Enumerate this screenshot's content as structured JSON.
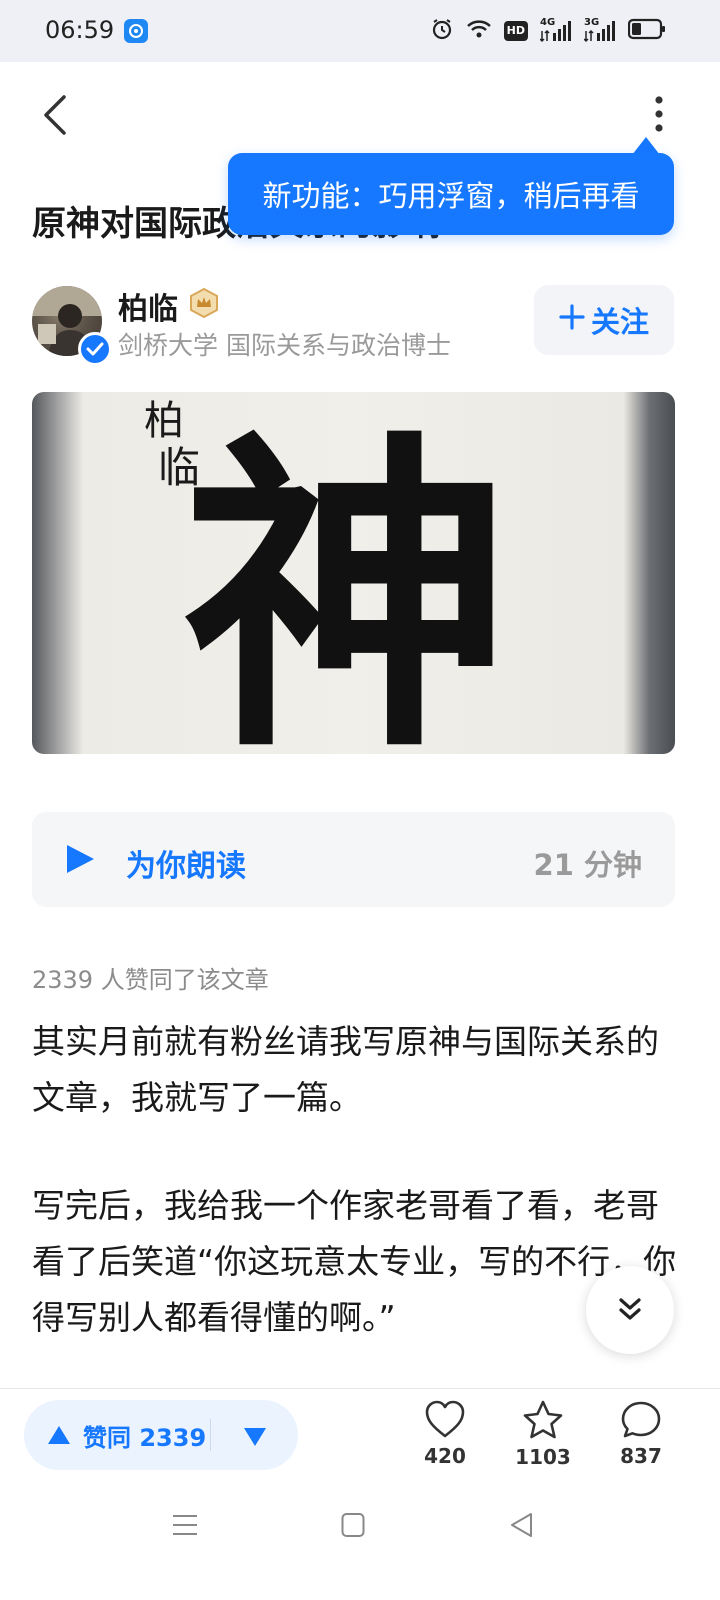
{
  "status_bar": {
    "time": "06:59",
    "icons": [
      "app-notification-icon",
      "alarm-icon",
      "wifi-icon",
      "hd-icon",
      "signal-4g-icon",
      "signal-3g-icon",
      "battery-icon"
    ],
    "hd_label": "HD",
    "net1": "4G",
    "net2": "3G"
  },
  "header": {
    "back_icon": "back-arrow-icon",
    "more_icon": "more-vertical-icon"
  },
  "tooltip": {
    "text": "新功能：巧用浮窗，稍后再看"
  },
  "article": {
    "title": "原神对国际政治关系的影响",
    "image_chars": [
      "柏",
      "临",
      "神"
    ]
  },
  "author": {
    "name": "柏临",
    "desc": "剑桥大学 国际关系与政治博士",
    "follow_label": "关注"
  },
  "listen": {
    "label": "为你朗读",
    "duration": "21 分钟"
  },
  "stats": {
    "likes_line": "2339 人赞同了该文章"
  },
  "body": {
    "p1": "其实月前就有粉丝请我写原神与国际关系的文章，我就写了一篇。",
    "p2": "写完后，我给我一个作家老哥看了看，老哥看了后笑道“你这玩意太专业，写的不行，你得写别人都看得懂的啊。”"
  },
  "actions": {
    "vote_label": "赞同 2339",
    "like_count": "420",
    "star_count": "1103",
    "comment_count": "837"
  },
  "colors": {
    "accent": "#1677ff",
    "status_bg": "#eef0f5",
    "muted": "#9a9a9a"
  }
}
